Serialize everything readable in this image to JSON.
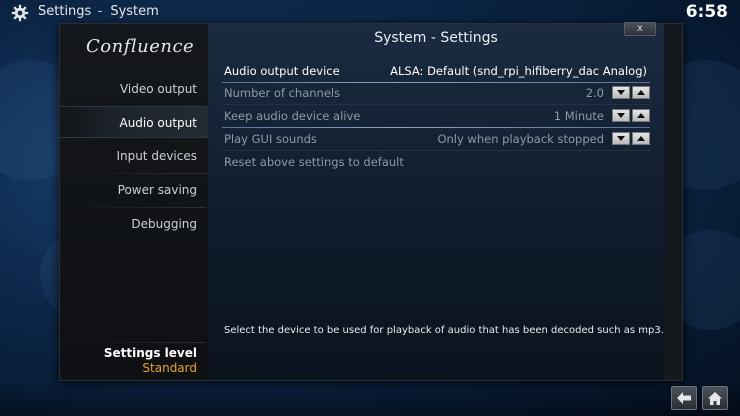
{
  "header": {
    "section": "Settings",
    "separator": "-",
    "subsection": "System",
    "clock": "6:58"
  },
  "sidebar": {
    "logo": "Confluence",
    "items": [
      {
        "label": "Video output"
      },
      {
        "label": "Audio output"
      },
      {
        "label": "Input devices"
      },
      {
        "label": "Power saving"
      },
      {
        "label": "Debugging"
      }
    ],
    "active_item": "Audio output",
    "settings_level_label": "Settings level",
    "settings_level_value": "Standard"
  },
  "panel": {
    "title": "System - Settings",
    "close_glyph": "x",
    "rows": [
      {
        "label": "Audio output device",
        "value": "ALSA: Default (snd_rpi_hifiberry_dac Analog)"
      },
      {
        "label": "Number of channels",
        "value": "2.0"
      },
      {
        "label": "Keep audio device alive",
        "value": "1 Minute"
      },
      {
        "label": "Play GUI sounds",
        "value": "Only when playback stopped"
      },
      {
        "label": "Reset above settings to default",
        "value": ""
      }
    ],
    "description": "Select the device to be used for playback of audio that has been decoded such as mp3."
  },
  "colors": {
    "accent": "#e8a21c",
    "background": "#0d2a4d",
    "text": "#ffffff"
  },
  "icons": {
    "top_left": "gear-icon",
    "back": "back-arrow-icon",
    "home": "home-icon"
  }
}
